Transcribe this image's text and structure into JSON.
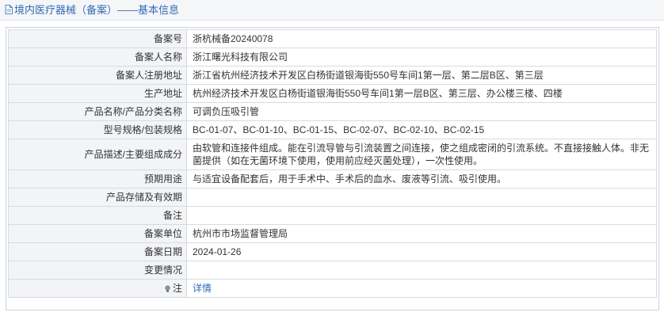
{
  "header": {
    "title": "境内医疗器械（备案）——基本信息"
  },
  "colors": {
    "accent": "#2f6bb5",
    "label_bg": "#f3f4f6",
    "border": "#d5dbe4"
  },
  "fields": [
    {
      "label": "备案号",
      "value": "浙杭械备20240078"
    },
    {
      "label": "备案人名称",
      "value": "浙江曙光科技有限公司"
    },
    {
      "label": "备案人注册地址",
      "value": "浙江省杭州经济技术开发区白杨街道银海街550号车间1第一层、第二层B区、第三层"
    },
    {
      "label": "生产地址",
      "value": "杭州经济技术开发区白杨街道银海街550号车间1第一层B区、第三层、办公楼三楼、四楼"
    },
    {
      "label": "产品名称/产品分类名称",
      "value": "可调负压吸引管"
    },
    {
      "label": "型号规格/包装规格",
      "value": "BC-01-07、BC-01-10、BC-01-15、BC-02-07、BC-02-10、BC-02-15"
    },
    {
      "label": "产品描述/主要组成成分",
      "value": "由软管和连接件组成。能在引流导管与引流装置之间连接，使之组成密闭的引流系统。不直接接触人体。非无菌提供（如在无菌环境下使用，使用前应经灭菌处理），一次性使用。"
    },
    {
      "label": "预期用途",
      "value": "与适宜设备配套后，用于手术中、手术后的血水、废液等引流、吸引使用。"
    },
    {
      "label": "产品存储及有效期",
      "value": ""
    },
    {
      "label": "备注",
      "value": ""
    },
    {
      "label": "备案单位",
      "value": "杭州市市场监督管理局"
    },
    {
      "label": "备案日期",
      "value": "2024-01-26"
    },
    {
      "label": "变更情况",
      "value": ""
    },
    {
      "label": "注",
      "value": "详情",
      "icon": "lamp-icon"
    }
  ]
}
